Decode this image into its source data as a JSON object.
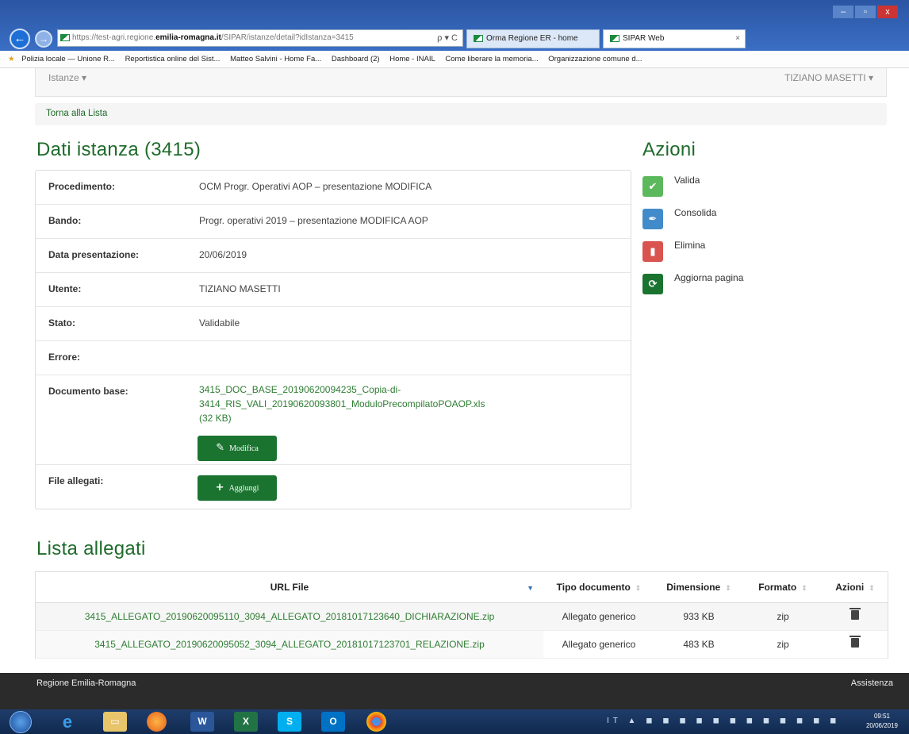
{
  "browser": {
    "url_prefix": "https://test-agri.regione.",
    "url_domain": "emilia-romagna.it",
    "url_path": "/SIPAR/istanze/detail?idIstanza=3415",
    "url_controls": "ρ ▾ C",
    "tabs": [
      {
        "label": "Orma Regione ER - home"
      },
      {
        "label": "SIPAR Web",
        "close": "×"
      }
    ],
    "window_controls": {
      "min": "–",
      "max": "▫",
      "close": "x"
    }
  },
  "bookmarks": [
    "Polizia locale — Unione R...",
    "Reportistica online del Sist...",
    "Matteo Salvini - Home Fa...",
    "Dashboard (2)",
    "Home - INAIL",
    "Come liberare la memoria...",
    "Organizzazione comune d..."
  ],
  "topnav": {
    "left": "Istanze ▾",
    "right": "TIZIANO MASETTI ▾"
  },
  "breadcrumb": {
    "back": "Torna alla Lista"
  },
  "dati": {
    "title": "Dati istanza (3415)",
    "rows": [
      {
        "label": "Procedimento:",
        "value": "OCM Progr. Operativi AOP – presentazione MODIFICA"
      },
      {
        "label": "Bando:",
        "value": "Progr. operativi 2019 – presentazione MODIFICA AOP"
      },
      {
        "label": "Data presentazione:",
        "value": "20/06/2019"
      },
      {
        "label": "Utente:",
        "value": "TIZIANO MASETTI"
      },
      {
        "label": "Stato:",
        "value": "Validabile"
      },
      {
        "label": "Errore:",
        "value": ""
      }
    ],
    "documento": {
      "label": "Documento base:",
      "link_line1": "3415_DOC_BASE_20190620094235_Copia-di-",
      "link_line2": "3414_RIS_VALI_20190620093801_ModuloPrecompilatoPOAOP.xls",
      "size": "(32 KB)",
      "button": "Modifica"
    },
    "allegati": {
      "label": "File allegati:",
      "button": "Aggiungi"
    }
  },
  "azioni": {
    "title": "Azioni",
    "items": [
      {
        "label": "Valida",
        "color": "#5cb85c"
      },
      {
        "label": "Consolida",
        "color": "#428bca"
      },
      {
        "label": "Elimina",
        "color": "#d9534f"
      },
      {
        "label": "Aggiorna pagina",
        "color": "#1a7430"
      }
    ]
  },
  "lista": {
    "title": "Lista allegati",
    "columns": [
      "URL File",
      "Tipo documento",
      "Dimensione",
      "Formato",
      "Azioni"
    ],
    "rows": [
      {
        "url": "3415_ALLEGATO_20190620095110_3094_ALLEGATO_20181017123640_DICHIARAZIONE.zip",
        "tipo": "Allegato generico",
        "dim": "933 KB",
        "formato": "zip"
      },
      {
        "url": "3415_ALLEGATO_20190620095052_3094_ALLEGATO_20181017123701_RELAZIONE.zip",
        "tipo": "Allegato generico",
        "dim": "483 KB",
        "formato": "zip"
      }
    ]
  },
  "footer": {
    "left": "Regione Emilia-Romagna",
    "right": "Assistenza"
  },
  "taskbar": {
    "lang": "IT",
    "time": "09:51",
    "date": "20/06/2019"
  },
  "colors": {
    "brand_green": "#1e6b2a",
    "button_green": "#1a7430",
    "link_green": "#2e7d32"
  }
}
